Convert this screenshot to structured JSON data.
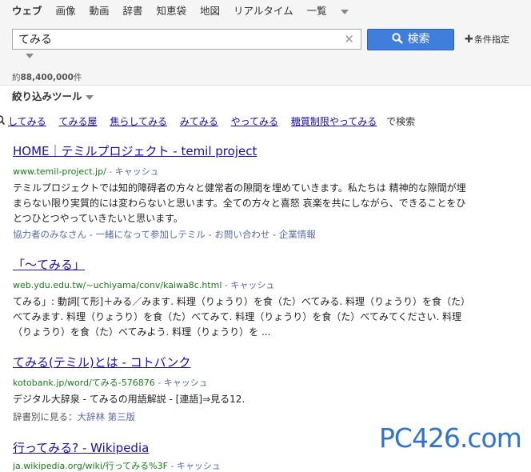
{
  "nav": {
    "tabs": [
      "ウェブ",
      "画像",
      "動画",
      "辞書",
      "知恵袋",
      "地図",
      "リアルタイム",
      "一覧"
    ]
  },
  "search": {
    "query": "てみる",
    "button_label": "検索",
    "conditions_label": "条件指定"
  },
  "results_count": {
    "prefix": "約",
    "count": "88,400,000",
    "suffix": "件"
  },
  "filter_tools": "絞り込みツール",
  "related": {
    "items": [
      "してみる",
      "てみる屋",
      "焦らしてみる",
      "みてみる",
      "やってみる",
      "糖質制限やってみる"
    ],
    "suffix": "で検索"
  },
  "results": [
    {
      "title": "HOME｜テミルプロジェクト - temil project",
      "url": "www.temil-project.jp/",
      "cache": "- キャッシュ",
      "snippet": "テミルプロジェクトでは知的障碍者の方々と健常者の隙間を埋めていきます。私たちは 精神的な隙間が埋まらない限り実質的には変わらないと思います。全ての方々と喜怒 哀楽を共にしながら、できることをひとつひとつやっていきたいと思います。",
      "sitelinks": "協力者のみなさん - 一緒になって参加しテミル - お問い合わせ - 企業情報"
    },
    {
      "title": "「～てみる」",
      "url": "web.ydu.edu.tw/~uchiyama/conv/kaiwa8c.html",
      "cache": "- キャッシュ",
      "snippet": "てみる」: 動詞[て形]＋みる／みます. 料理（りょうり）を食（た）べてみる. 料理（りょうり）を食（た）べてみます. 料理（りょうり）を食（た）べてみて. 料理（りょうり）を食（た）べてみてください. 料理（りょうり）を食（た）べてみよう. 料理（りょうり）を ..."
    },
    {
      "title": "てみる(テミル)とは - コトバンク",
      "url": "kotobank.jp/word/てみる-576876",
      "cache": "- キャッシュ",
      "snippet": "デジタル大辞泉 - てみるの用語解説 - [連語]⇒見る12.",
      "subline_prefix": "辞書別に見る：",
      "subline_link": "大辞林 第三版"
    },
    {
      "title": "行ってみる? - Wikipedia",
      "url": "ja.wikipedia.org/wiki/行ってみる%3F",
      "cache": "- キャッシュ"
    }
  ],
  "watermark": "PC426.com"
}
